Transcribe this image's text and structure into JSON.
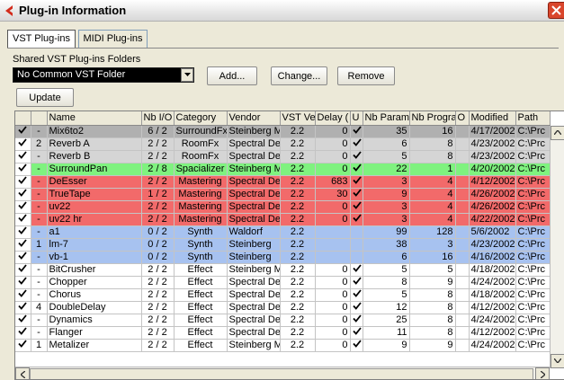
{
  "window": {
    "title": "Plug-in Information"
  },
  "tabs": [
    {
      "label": "VST Plug-ins",
      "active": true
    },
    {
      "label": "MIDI Plug-ins",
      "active": false
    }
  ],
  "shared": {
    "label": "Shared VST Plug-ins Folders",
    "selected_folder": "No Common VST Folder",
    "add_label": "Add...",
    "change_label": "Change...",
    "remove_label": "Remove"
  },
  "update_label": "Update",
  "table": {
    "headers": [
      "",
      "",
      "Name",
      "Nb I/O",
      "Category",
      "Vendor",
      "VST Ve",
      "Delay (",
      "U",
      "Nb Params",
      "Nb Progra",
      "O",
      "Modified",
      "Path"
    ],
    "rows": [
      {
        "style": "gray sel",
        "checked": true,
        "num": "-",
        "name": "Mix6to2",
        "io": "6 / 2",
        "category": "SurroundFx",
        "vendor": "Steinberg Med",
        "vst": "2.2",
        "delay": "0",
        "u": true,
        "params": "35",
        "progs": "16",
        "o": "",
        "modified": "4/17/2002",
        "path": "C:\\Prc"
      },
      {
        "style": "gray",
        "checked": true,
        "num": "2",
        "name": "Reverb A",
        "io": "2 / 2",
        "category": "RoomFx",
        "vendor": "Spectral Desig",
        "vst": "2.2",
        "delay": "0",
        "u": true,
        "params": "6",
        "progs": "8",
        "o": "",
        "modified": "4/23/2002",
        "path": "C:\\Prc"
      },
      {
        "style": "gray",
        "checked": true,
        "num": "-",
        "name": "Reverb B",
        "io": "2 / 2",
        "category": "RoomFx",
        "vendor": "Spectral Desig",
        "vst": "2.2",
        "delay": "0",
        "u": true,
        "params": "5",
        "progs": "8",
        "o": "",
        "modified": "4/23/2002",
        "path": "C:\\Prc"
      },
      {
        "style": "green",
        "checked": true,
        "num": "-",
        "name": "SurroundPan",
        "io": "2 / 8",
        "category": "Spacializer",
        "vendor": "Steinberg Med",
        "vst": "2.2",
        "delay": "0",
        "u": true,
        "params": "22",
        "progs": "1",
        "o": "",
        "modified": "4/20/2002",
        "path": "C:\\Prc"
      },
      {
        "style": "red",
        "checked": true,
        "num": "-",
        "name": "DeEsser",
        "io": "2 / 2",
        "category": "Mastering",
        "vendor": "Spectral Desig",
        "vst": "2.2",
        "delay": "683",
        "u": true,
        "params": "3",
        "progs": "4",
        "o": "",
        "modified": "4/12/2002",
        "path": "C:\\Prc"
      },
      {
        "style": "red",
        "checked": true,
        "num": "-",
        "name": "TrueTape",
        "io": "1 / 2",
        "category": "Mastering",
        "vendor": "Spectral Desig",
        "vst": "2.2",
        "delay": "30",
        "u": true,
        "params": "9",
        "progs": "4",
        "o": "",
        "modified": "4/26/2002",
        "path": "C:\\Prc"
      },
      {
        "style": "red",
        "checked": true,
        "num": "-",
        "name": "uv22",
        "io": "2 / 2",
        "category": "Mastering",
        "vendor": "Spectral Desig",
        "vst": "2.2",
        "delay": "0",
        "u": true,
        "params": "3",
        "progs": "4",
        "o": "",
        "modified": "4/26/2002",
        "path": "C:\\Prc"
      },
      {
        "style": "red",
        "checked": true,
        "num": "-",
        "name": "uv22 hr",
        "io": "2 / 2",
        "category": "Mastering",
        "vendor": "Spectral Desig",
        "vst": "2.2",
        "delay": "0",
        "u": true,
        "params": "3",
        "progs": "4",
        "o": "",
        "modified": "4/22/2002",
        "path": "C:\\Prc"
      },
      {
        "style": "blue",
        "checked": true,
        "num": "-",
        "name": "a1",
        "io": "0 / 2",
        "category": "Synth",
        "vendor": "Waldorf",
        "vst": "2.2",
        "delay": "",
        "u": false,
        "params": "99",
        "progs": "128",
        "o": "",
        "modified": "5/6/2002",
        "path": "C:\\Prc"
      },
      {
        "style": "blue",
        "checked": true,
        "num": "1",
        "name": "lm-7",
        "io": "0 / 2",
        "category": "Synth",
        "vendor": "Steinberg",
        "vst": "2.2",
        "delay": "",
        "u": false,
        "params": "38",
        "progs": "3",
        "o": "",
        "modified": "4/23/2002",
        "path": "C:\\Prc"
      },
      {
        "style": "blue",
        "checked": true,
        "num": "-",
        "name": "vb-1",
        "io": "0 / 2",
        "category": "Synth",
        "vendor": "Steinberg",
        "vst": "2.2",
        "delay": "",
        "u": false,
        "params": "6",
        "progs": "16",
        "o": "",
        "modified": "4/16/2002",
        "path": "C:\\Prc"
      },
      {
        "style": "white",
        "checked": true,
        "num": "-",
        "name": "BitCrusher",
        "io": "2 / 2",
        "category": "Effect",
        "vendor": "Steinberg Med",
        "vst": "2.2",
        "delay": "0",
        "u": true,
        "params": "5",
        "progs": "5",
        "o": "",
        "modified": "4/18/2002",
        "path": "C:\\Prc"
      },
      {
        "style": "white",
        "checked": true,
        "num": "-",
        "name": "Chopper",
        "io": "2 / 2",
        "category": "Effect",
        "vendor": "Spectral Desig",
        "vst": "2.2",
        "delay": "0",
        "u": true,
        "params": "8",
        "progs": "9",
        "o": "",
        "modified": "4/24/2002",
        "path": "C:\\Prc"
      },
      {
        "style": "white",
        "checked": true,
        "num": "-",
        "name": "Chorus",
        "io": "2 / 2",
        "category": "Effect",
        "vendor": "Spectral Desig",
        "vst": "2.2",
        "delay": "0",
        "u": true,
        "params": "5",
        "progs": "8",
        "o": "",
        "modified": "4/18/2002",
        "path": "C:\\Prc"
      },
      {
        "style": "white",
        "checked": true,
        "num": "4",
        "name": "DoubleDelay",
        "io": "2 / 2",
        "category": "Effect",
        "vendor": "Spectral Desig",
        "vst": "2.2",
        "delay": "0",
        "u": true,
        "params": "12",
        "progs": "8",
        "o": "",
        "modified": "4/12/2002",
        "path": "C:\\Prc"
      },
      {
        "style": "white",
        "checked": true,
        "num": "-",
        "name": "Dynamics",
        "io": "2 / 2",
        "category": "Effect",
        "vendor": "Spectral Desig",
        "vst": "2.2",
        "delay": "0",
        "u": true,
        "params": "25",
        "progs": "8",
        "o": "",
        "modified": "4/24/2002",
        "path": "C:\\Prc"
      },
      {
        "style": "white",
        "checked": true,
        "num": "-",
        "name": "Flanger",
        "io": "2 / 2",
        "category": "Effect",
        "vendor": "Spectral Desig",
        "vst": "2.2",
        "delay": "0",
        "u": true,
        "params": "11",
        "progs": "8",
        "o": "",
        "modified": "4/12/2002",
        "path": "C:\\Prc"
      },
      {
        "style": "white",
        "checked": true,
        "num": "1",
        "name": "Metalizer",
        "io": "2 / 2",
        "category": "Effect",
        "vendor": "Steinberg Med",
        "vst": "2.2",
        "delay": "0",
        "u": true,
        "params": "9",
        "progs": "9",
        "o": "",
        "modified": "4/24/2002",
        "path": "C:\\Prc"
      }
    ]
  },
  "icons": {
    "app": "cubase-logo-icon",
    "close": "close-icon",
    "check": "check-icon"
  },
  "colors": {
    "row_gray": "#d5d5d5",
    "row_green": "#7ff27f",
    "row_red": "#f26a6a",
    "row_blue": "#a7c2f0",
    "close": "#d9462c"
  }
}
